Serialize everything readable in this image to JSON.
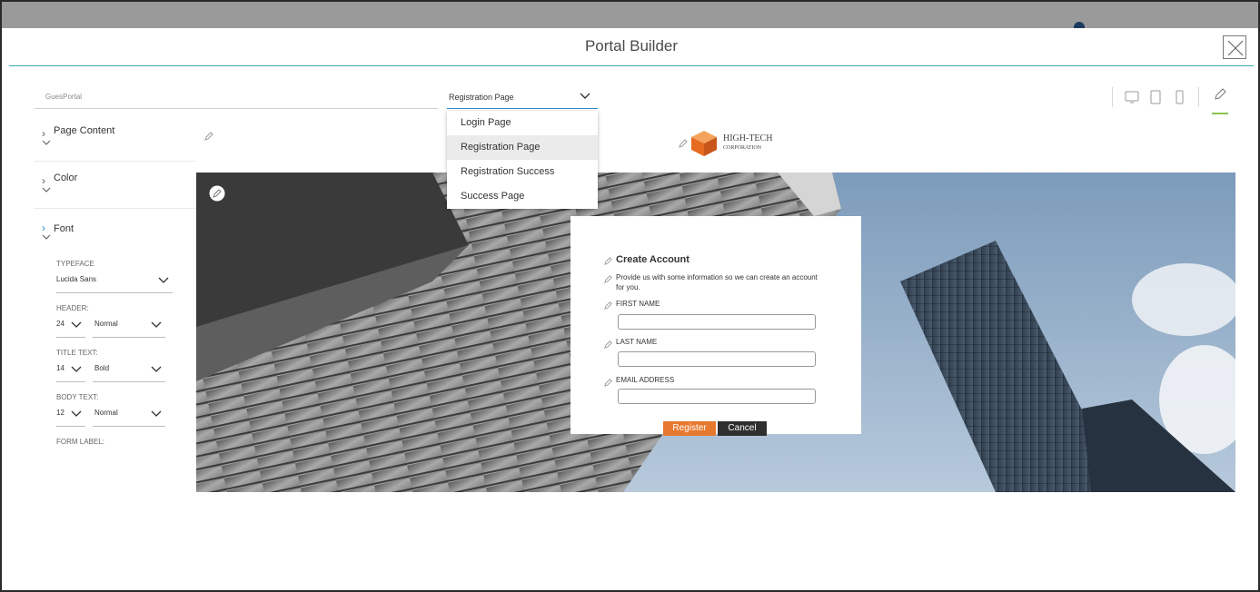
{
  "window": {
    "title": "Portal Builder"
  },
  "toolbar": {
    "portal_name": "GuesPortal",
    "page_select": "Registration Page",
    "page_options": [
      "Login Page",
      "Registration Page",
      "Registration Success",
      "Success Page"
    ],
    "active_option": "Registration Page"
  },
  "sidebar": {
    "sections": [
      {
        "label": "Page Content"
      },
      {
        "label": "Color"
      },
      {
        "label": "Font"
      }
    ],
    "font": {
      "typeface_label": "TYPEFACE",
      "typeface_value": "Lucida Sans",
      "header_label": "HEADER:",
      "header_size": "24",
      "header_weight": "Normal",
      "title_label": "TITLE TEXT:",
      "title_size": "14",
      "title_weight": "Bold",
      "body_label": "BODY TEXT:",
      "body_size": "12",
      "body_weight": "Normal",
      "form_label": "FORM LABEL:"
    }
  },
  "preview": {
    "logo_line1": "HIGH-TECH",
    "logo_line2": "CORPORATION",
    "form": {
      "title": "Create Account",
      "description": "Provide us with some information so we can create an account for you.",
      "first_name_label": "FIRST NAME",
      "last_name_label": "LAST NAME",
      "email_label": "EMAIL ADDRESS",
      "register_label": "Register",
      "cancel_label": "Cancel"
    }
  },
  "colors": {
    "accent": "#2b8fc9",
    "teal_divider": "#3fa9b5",
    "register_button": "#e6792e",
    "cancel_button": "#2f2f2f",
    "edit_tab_indicator": "#8bc34a"
  },
  "icons": [
    "close-icon",
    "chevron-down-icon",
    "chevron-right-icon",
    "desktop-icon",
    "tablet-icon",
    "phone-icon",
    "pencil-icon",
    "logo-cube-icon"
  ]
}
